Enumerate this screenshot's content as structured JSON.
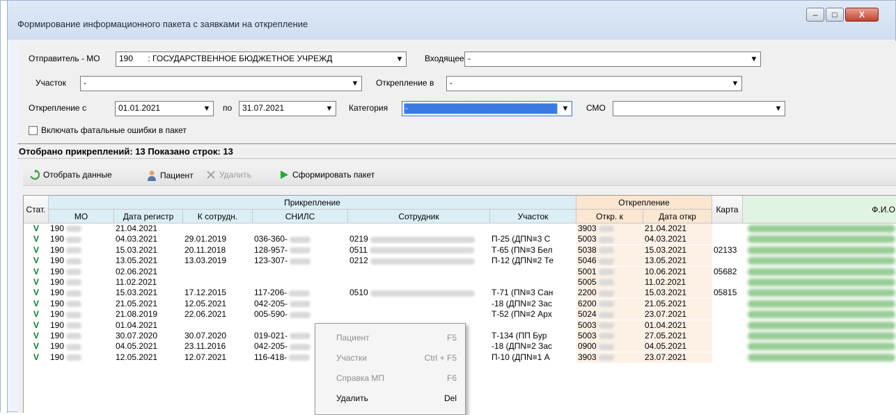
{
  "window": {
    "title": "Формирование информационного пакета с заявками на открепление",
    "controls": {
      "minimize": "–",
      "maximize": "□",
      "close": "X"
    }
  },
  "filters": {
    "sender_label": "Отправитель - МО",
    "sender_code": "190",
    "sender_value": ": ГОСУДАРСТВЕННОЕ БЮДЖЕТНОЕ УЧРЕЖД",
    "incoming_label": "Входящее",
    "incoming_value": "-",
    "district_label": "Участок",
    "district_value": "-",
    "detach_to_label": "Открепление в",
    "detach_to_value": "-",
    "detach_from_label": "Открепление с",
    "date_from": "01.01.2021",
    "to_label": "по",
    "date_to": "31.07.2021",
    "category_label": "Категория",
    "category_value": "-",
    "smo_label": "СМО",
    "smo_value": "",
    "include_fatal_label": "Включать фатальные ошибки в пакет"
  },
  "summary": "Отобрано прикреплений: 13 Показано строк: 13",
  "toolbar": {
    "select_data": "Отобрать данные",
    "patient": "Пациент",
    "delete": "Удалить",
    "build_package": "Сформировать пакет"
  },
  "grid": {
    "group_headers": {
      "attachment": "Прикрепление",
      "detachment": "Открепление",
      "card": "Карта",
      "fio": "Ф.И.О"
    },
    "headers": {
      "status": "Стат.",
      "mo": "МО",
      "reg_date": "Дата регистр",
      "to_employee": "К сотрудн.",
      "snils": "СНИЛС",
      "employee": "Сотрудник",
      "district": "Участок",
      "detach_to": "Откр. к",
      "detach_date": "Дата откр"
    },
    "rows": [
      {
        "status": "V",
        "mo": "190",
        "reg": "21.04.2021",
        "to_emp": "",
        "snils": "",
        "emp": "",
        "district": "",
        "detach_to": "3903",
        "detach_date": "21.04.2021",
        "card": ""
      },
      {
        "status": "V",
        "mo": "190",
        "reg": "04.03.2021",
        "to_emp": "29.01.2019",
        "snils": "036-360-",
        "emp": "0219",
        "district": "П-25 (ДПN≡3 С",
        "detach_to": "5003",
        "detach_date": "04.03.2021",
        "card": ""
      },
      {
        "status": "V",
        "mo": "190",
        "reg": "15.03.2021",
        "to_emp": "20.11.2018",
        "snils": "128-957-",
        "emp": "0511",
        "district": "Т-65 (ПN≡3 Бел",
        "detach_to": "5038",
        "detach_date": "15.03.2021",
        "card": "02133"
      },
      {
        "status": "V",
        "mo": "190",
        "reg": "13.05.2021",
        "to_emp": "13.03.2019",
        "snils": "123-307-",
        "emp": "0212",
        "district": "П-12 (ДПN≡2 Те",
        "detach_to": "5046",
        "detach_date": "13.05.2021",
        "card": ""
      },
      {
        "status": "V",
        "mo": "190",
        "reg": "02.06.2021",
        "to_emp": "",
        "snils": "",
        "emp": "",
        "district": "",
        "detach_to": "5001",
        "detach_date": "10.06.2021",
        "card": "05682"
      },
      {
        "status": "V",
        "mo": "190",
        "reg": "11.02.2021",
        "to_emp": "",
        "snils": "",
        "emp": "",
        "district": "",
        "detach_to": "5005",
        "detach_date": "11.02.2021",
        "card": ""
      },
      {
        "status": "V",
        "mo": "190",
        "reg": "15.03.2021",
        "to_emp": "17.12.2015",
        "snils": "117-206-",
        "emp": "0510",
        "district": "Т-71 (ПN≡3 Сан",
        "detach_to": "2200",
        "detach_date": "15.03.2021",
        "card": "05815"
      },
      {
        "status": "V",
        "mo": "190",
        "reg": "21.05.2021",
        "to_emp": "12.05.2021",
        "snils": "042-205-",
        "emp": "",
        "district": "-18 (ДПN≡2 Зас",
        "detach_to": "6200",
        "detach_date": "21.05.2021",
        "card": ""
      },
      {
        "status": "V",
        "mo": "190",
        "reg": "21.08.2019",
        "to_emp": "22.06.2021",
        "snils": "005-590-",
        "emp": "",
        "district": "Т-52 (ПN≡2 Арх",
        "detach_to": "5024",
        "detach_date": "23.07.2021",
        "card": ""
      },
      {
        "status": "V",
        "mo": "190",
        "reg": "01.04.2021",
        "to_emp": "",
        "snils": "",
        "emp": "",
        "district": "",
        "detach_to": "5003",
        "detach_date": "01.04.2021",
        "card": ""
      },
      {
        "status": "V",
        "mo": "190",
        "reg": "30.07.2020",
        "to_emp": "30.07.2020",
        "snils": "019-021-",
        "emp": "",
        "district": "Т-134 (ПП Бур",
        "detach_to": "5003",
        "detach_date": "27.05.2021",
        "card": ""
      },
      {
        "status": "V",
        "mo": "190",
        "reg": "04.05.2021",
        "to_emp": "23.11.2016",
        "snils": "042-205-",
        "emp": "",
        "district": "-18 (ДПN≡2 Зас",
        "detach_to": "0900",
        "detach_date": "04.05.2021",
        "card": ""
      },
      {
        "status": "V",
        "mo": "190",
        "reg": "12.05.2021",
        "to_emp": "12.07.2021",
        "snils": "116-418-",
        "emp": "",
        "district": "П-10 (ДПN≡1 А",
        "detach_to": "3903",
        "detach_date": "23.07.2021",
        "card": ""
      }
    ]
  },
  "context_menu": {
    "items": [
      {
        "label": "Пациент",
        "key": "F5",
        "enabled": false
      },
      {
        "label": "Участки",
        "key": "Ctrl + F5",
        "enabled": false
      },
      {
        "label": "Справка МП",
        "key": "F6",
        "enabled": false
      },
      {
        "label": "Удалить",
        "key": "Del",
        "enabled": true
      }
    ]
  },
  "colors": {
    "accent": "#3a7be3",
    "status_check": "#0b7a2a"
  }
}
